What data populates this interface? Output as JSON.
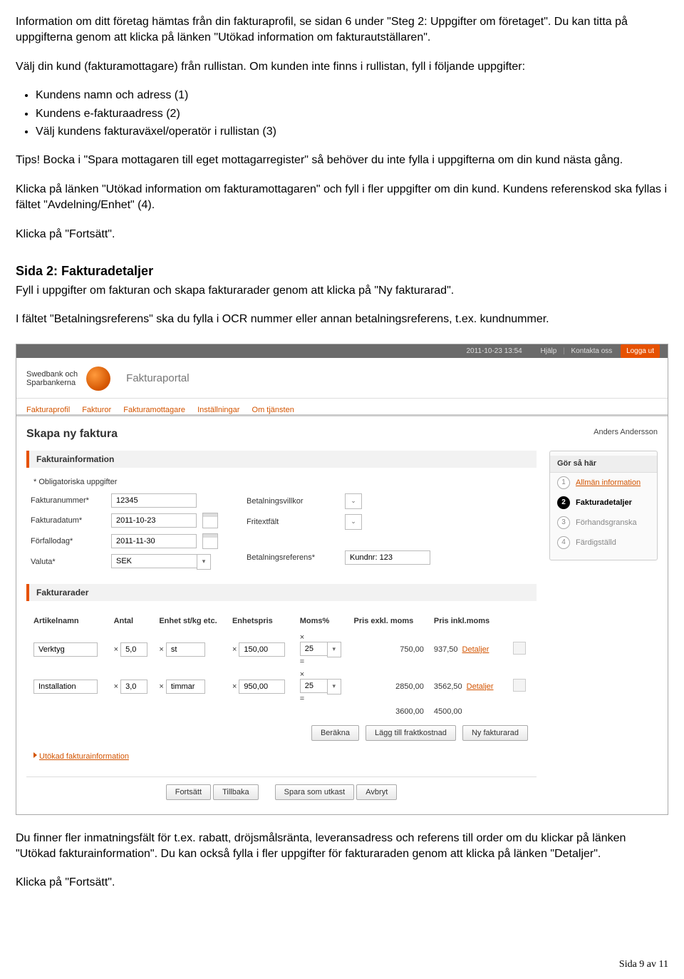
{
  "doc": {
    "p1": "Information om ditt företag hämtas från din fakturaprofil, se sidan 6 under \"Steg 2: Uppgifter om företaget\". Du kan titta på uppgifterna genom att klicka på länken \"Utökad information om fakturautställaren\".",
    "p2": "Välj din kund (fakturamottagare) från rullistan. Om kunden inte finns i rullistan, fyll i följande uppgifter:",
    "bul1": "Kundens namn och adress (1)",
    "bul2": "Kundens e-fakturaadress (2)",
    "bul3": "Välj kundens fakturaväxel/operatör i rullistan (3)",
    "p3": "Tips! Bocka i \"Spara mottagaren till eget mottagarregister\" så behöver du inte fylla i uppgifterna om din kund nästa gång.",
    "p4": "Klicka på länken \"Utökad information om fakturamottagaren\" och fyll i fler uppgifter om din kund. Kundens referenskod ska fyllas i fältet \"Avdelning/Enhet\" (4).",
    "p5": "Klicka på \"Fortsätt\".",
    "h2": "Sida 2: Fakturadetaljer",
    "p6": "Fyll i uppgifter om fakturan och skapa fakturarader genom att klicka på \"Ny fakturarad\".",
    "p7": "I fältet \"Betalningsreferens\" ska du fylla i OCR nummer eller annan betalningsreferens, t.ex. kundnummer.",
    "p8": "Du finner fler inmatningsfält för t.ex. rabatt, dröjsmålsränta, leveransadress och referens till order om du klickar på länken \"Utökad fakturainformation\". Du kan också fylla i fler uppgifter för fakturaraden genom att klicka på länken \"Detaljer\".",
    "p9": "Klicka på \"Fortsätt\".",
    "pager": "Sida 9 av 11"
  },
  "ui": {
    "topbar": {
      "datetime": "2011-10-23 13:54",
      "help": "Hjälp",
      "contact": "Kontakta oss",
      "logout": "Logga ut"
    },
    "brand_line1": "Swedbank och",
    "brand_line2": "Sparbankerna",
    "portal": "Fakturaportal",
    "nav": [
      "Fakturaprofil",
      "Fakturor",
      "Fakturamottagare",
      "Inställningar",
      "Om tjänsten"
    ],
    "page_title": "Skapa ny faktura",
    "user": "Anders Andersson",
    "panel_info": "Fakturainformation",
    "oblig": "* Obligatoriska uppgifter",
    "left_labels": {
      "no": "Fakturanummer*",
      "date": "Fakturadatum*",
      "due": "Förfallodag*",
      "cur": "Valuta*"
    },
    "left_values": {
      "no": "12345",
      "date": "2011-10-23",
      "due": "2011-11-30",
      "cur": "SEK"
    },
    "right_labels": {
      "terms": "Betalningsvillkor",
      "free": "Fritextfält",
      "ref": "Betalningsreferens*"
    },
    "right_values": {
      "ref": "Kundnr: 123"
    },
    "panel_rows": "Fakturarader",
    "headers": {
      "art": "Artikelnamn",
      "ant": "Antal",
      "enh": "Enhet st/kg etc.",
      "pris": "Enhetspris",
      "moms": "Moms%",
      "ex": "Pris exkl. moms",
      "ink": "Pris inkl.moms"
    },
    "rows": [
      {
        "art": "Verktyg",
        "ant": "5,0",
        "enh": "st",
        "pris": "150,00",
        "moms": "25",
        "ex": "750,00",
        "ink": "937,50"
      },
      {
        "art": "Installation",
        "ant": "3,0",
        "enh": "timmar",
        "pris": "950,00",
        "moms": "25",
        "ex": "2850,00",
        "ink": "3562,50"
      }
    ],
    "totals": {
      "ex": "3600,00",
      "ink": "4500,00"
    },
    "detaljer": "Detaljer",
    "row_btns": {
      "calc": "Beräkna",
      "ship": "Lägg till fraktkostnad",
      "new": "Ny fakturarad"
    },
    "utokad": "Utökad fakturainformation",
    "nav_btns": {
      "cont": "Fortsätt",
      "back": "Tillbaka",
      "draft": "Spara som utkast",
      "cancel": "Avbryt"
    },
    "side": {
      "title": "Gör så här",
      "s1": "Allmän information",
      "s2": "Fakturadetaljer",
      "s3": "Förhandsgranska",
      "s4": "Färdigställd"
    }
  }
}
